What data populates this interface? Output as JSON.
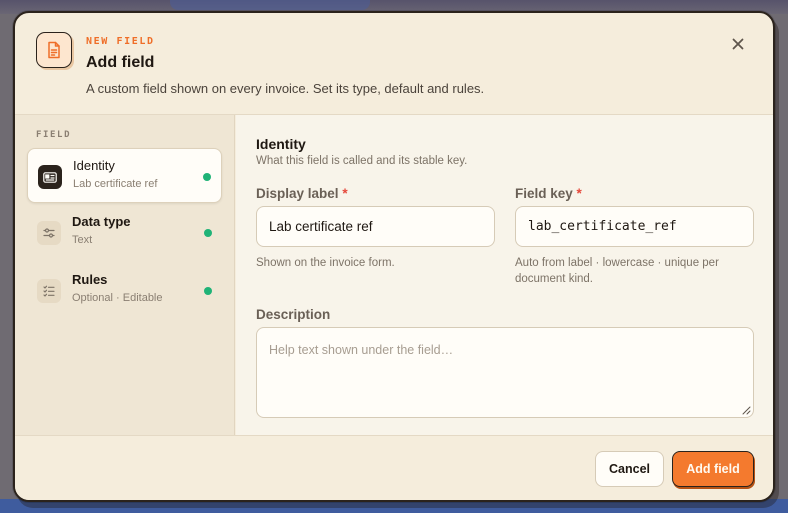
{
  "header": {
    "eyebrow": "NEW FIELD",
    "title": "Add field",
    "subtitle": "A custom field shown on every invoice. Set its type, default and rules.",
    "icon": "document-icon",
    "close_icon": "close-icon"
  },
  "sidebar": {
    "heading": "FIELD",
    "steps": [
      {
        "label": "Identity",
        "sub": "Lab certificate ref",
        "icon": "id-card-icon",
        "active": true,
        "status": "complete"
      },
      {
        "label": "Data type",
        "sub": "Text",
        "icon": "sliders-icon",
        "active": false,
        "status": "complete"
      },
      {
        "label": "Rules",
        "sub": "Optional · Editable",
        "icon": "checklist-icon",
        "active": false,
        "status": "complete"
      }
    ]
  },
  "content": {
    "title": "Identity",
    "subtitle": "What this field is called and its stable key.",
    "display_label": {
      "label": "Display label",
      "required_marker": "*",
      "value": "Lab certificate ref",
      "help": "Shown on the invoice form."
    },
    "field_key": {
      "label": "Field key",
      "required_marker": "*",
      "value": "lab_certificate_ref",
      "help_line1": "Auto from label · lowercase · unique per",
      "help_line2": "document kind."
    },
    "description": {
      "label": "Description",
      "placeholder": "Help text shown under the field…"
    }
  },
  "footer": {
    "cancel_label": "Cancel",
    "submit_label": "Add field"
  },
  "colors": {
    "accent": "#f47a2e",
    "eyebrow": "#ef6e28",
    "status_dot": "#1fb377",
    "required": "#e5483b"
  }
}
